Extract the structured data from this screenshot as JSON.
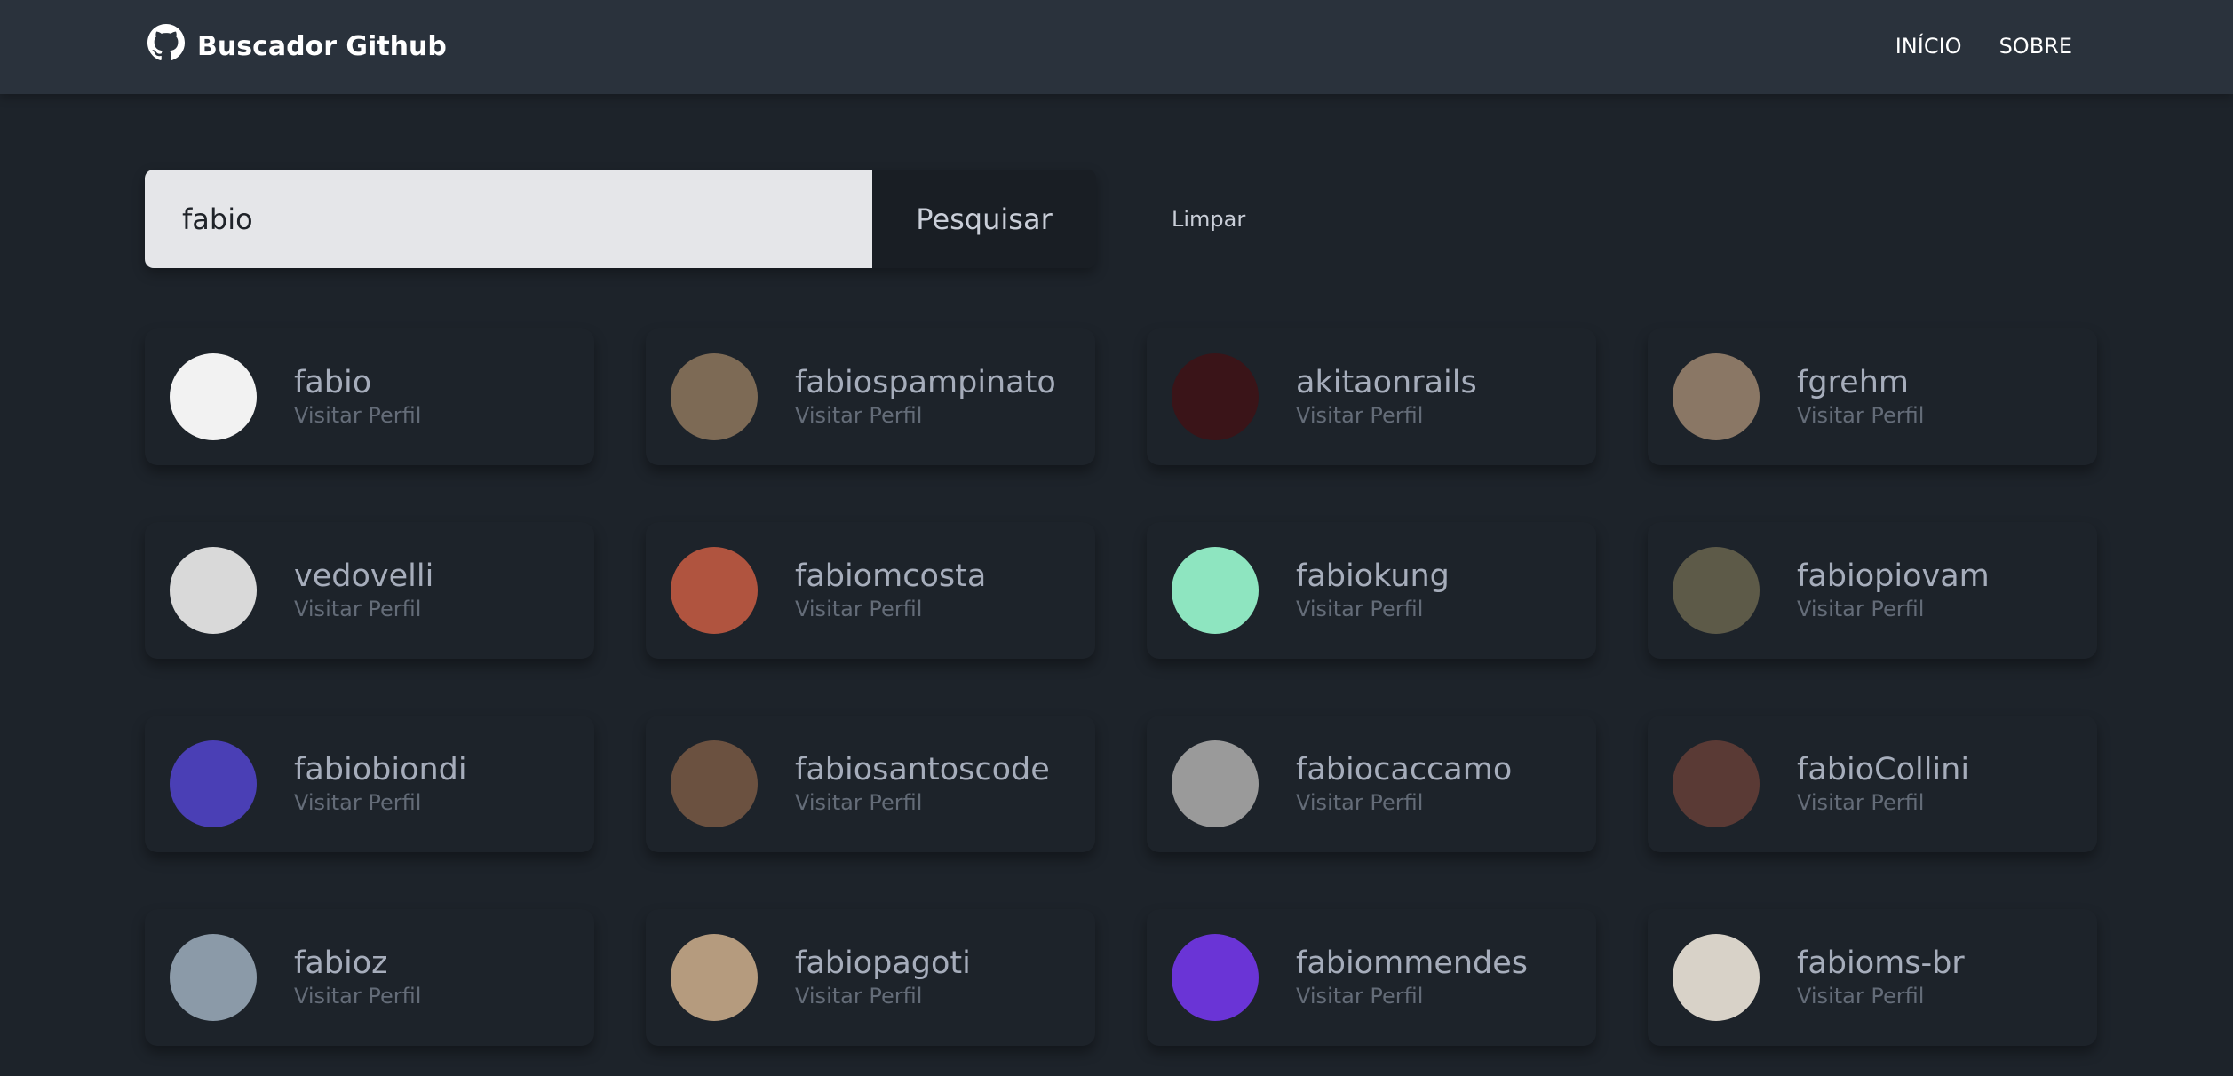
{
  "header": {
    "brand": "Buscador Github",
    "nav": [
      "INÍCIO",
      "SOBRE"
    ]
  },
  "search": {
    "value": "fabio",
    "button_label": "Pesquisar",
    "clear_label": "Limpar"
  },
  "results": [
    {
      "login": "fabio",
      "link": "Visitar Perfil",
      "avatar_color": "#f2f2f2"
    },
    {
      "login": "fabiospampinato",
      "link": "Visitar Perfil",
      "avatar_color": "#7d6a55"
    },
    {
      "login": "akitaonrails",
      "link": "Visitar Perfil",
      "avatar_color": "#3a1418"
    },
    {
      "login": "fgrehm",
      "link": "Visitar Perfil",
      "avatar_color": "#8a7765"
    },
    {
      "login": "vedovelli",
      "link": "Visitar Perfil",
      "avatar_color": "#d9d9d9"
    },
    {
      "login": "fabiomcosta",
      "link": "Visitar Perfil",
      "avatar_color": "#b0543f"
    },
    {
      "login": "fabiokung",
      "link": "Visitar Perfil",
      "avatar_color": "#8ee5c0"
    },
    {
      "login": "fabiopiovam",
      "link": "Visitar Perfil",
      "avatar_color": "#5d5a48"
    },
    {
      "login": "fabiobiondi",
      "link": "Visitar Perfil",
      "avatar_color": "#4a3fb5"
    },
    {
      "login": "fabiosantoscode",
      "link": "Visitar Perfil",
      "avatar_color": "#6b5140"
    },
    {
      "login": "fabiocaccamo",
      "link": "Visitar Perfil",
      "avatar_color": "#9a9a9a"
    },
    {
      "login": "fabioCollini",
      "link": "Visitar Perfil",
      "avatar_color": "#5a3a35"
    },
    {
      "login": "fabioz",
      "link": "Visitar Perfil",
      "avatar_color": "#8b9aa8"
    },
    {
      "login": "fabiopagoti",
      "link": "Visitar Perfil",
      "avatar_color": "#b59b7e"
    },
    {
      "login": "fabiommendes",
      "link": "Visitar Perfil",
      "avatar_color": "#6a34d6"
    },
    {
      "login": "fabioms-br",
      "link": "Visitar Perfil",
      "avatar_color": "#d8d2c8"
    }
  ]
}
